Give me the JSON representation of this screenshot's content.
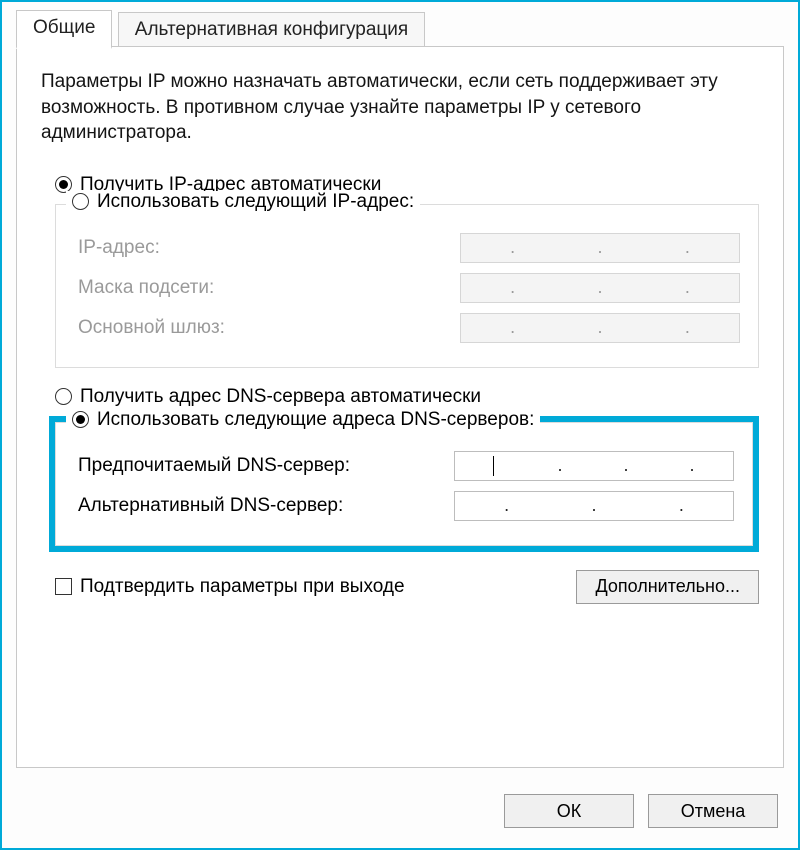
{
  "tabs": {
    "general": "Общие",
    "alt_config": "Альтернативная конфигурация"
  },
  "description": "Параметры IP можно назначать автоматически, если сеть поддерживает эту возможность. В противном случае узнайте параметры IP у сетевого администратора.",
  "ip_section": {
    "auto_label": "Получить IP-адрес автоматически",
    "manual_label": "Использовать следующий IP-адрес:",
    "ip_address_label": "IP-адрес:",
    "subnet_label": "Маска подсети:",
    "gateway_label": "Основной шлюз:",
    "selected": "auto"
  },
  "dns_section": {
    "auto_label": "Получить адрес DNS-сервера автоматически",
    "manual_label": "Использовать следующие адреса DNS-серверов:",
    "preferred_label": "Предпочитаемый DNS-сервер:",
    "alternate_label": "Альтернативный DNS-сервер:",
    "selected": "manual"
  },
  "confirm_label": "Подтвердить параметры при выходе",
  "advanced_button": "Дополнительно...",
  "ok_button": "ОК",
  "cancel_button": "Отмена"
}
